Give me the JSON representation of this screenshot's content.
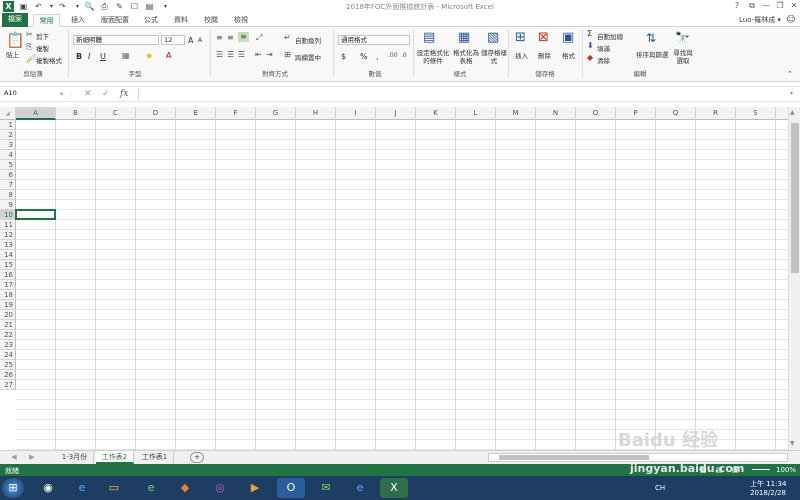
{
  "title_bar": {
    "title": "2018年FOC外面推檢統計表 - Microsoft Excel",
    "qa_icons": [
      "excel-icon",
      "save-icon",
      "undo-icon",
      "redo-icon",
      "print-preview-icon",
      "quick-print-icon",
      "spell-icon",
      "form-icon",
      "more-icon"
    ],
    "window_controls": [
      "?",
      "⧉",
      "—",
      "❐",
      "✕"
    ]
  },
  "tabs": {
    "file": "檔案",
    "items": [
      "常用",
      "插入",
      "版面配置",
      "公式",
      "資料",
      "校閱",
      "檢視"
    ],
    "account": "Luo-羅林成 ▾"
  },
  "ribbon": {
    "clipboard": {
      "paste": "貼上",
      "cut": "剪下",
      "copy": "複製",
      "format_painter": "複製格式",
      "label": "剪貼簿"
    },
    "font": {
      "name": "新細明體",
      "size": "12",
      "label": "字型",
      "grow": "A",
      "shrink": "A",
      "bold": "B",
      "italic": "I",
      "underline": "U",
      "color_a": "A"
    },
    "alignment": {
      "wrap": "自動換列",
      "merge": "跨欄置中",
      "label": "對齊方式"
    },
    "number": {
      "format": "通用格式",
      "currency": "$",
      "percent": "%",
      "comma": ",",
      "label": "數值"
    },
    "styles": {
      "cond": "設定格式化的條件",
      "table": "格式化為表格",
      "cell": "儲存格樣式",
      "label": "樣式"
    },
    "cells": {
      "insert": "插入",
      "delete": "刪除",
      "format": "格式",
      "label": "儲存格"
    },
    "editing": {
      "autosum": "自動加總",
      "fill": "填滿",
      "clear": "清除",
      "sort": "排序與篩選",
      "find": "尋找與選取",
      "label": "編輯"
    }
  },
  "formula_bar": {
    "name_box": "A10",
    "fx": "fx",
    "cancel": "✕",
    "enter": "✓",
    "value": ""
  },
  "columns": [
    "A",
    "B",
    "C",
    "D",
    "E",
    "F",
    "G",
    "H",
    "I",
    "J",
    "K",
    "L",
    "M",
    "N",
    "O",
    "P",
    "Q",
    "R",
    "S"
  ],
  "rows": [
    "1",
    "2",
    "3",
    "4",
    "5",
    "6",
    "7",
    "8",
    "9",
    "10",
    "11",
    "12",
    "13",
    "14",
    "15",
    "16",
    "17",
    "18",
    "19",
    "20",
    "21",
    "22",
    "23",
    "24",
    "25",
    "26",
    "27"
  ],
  "selected_cell": {
    "col": "A",
    "row": "10"
  },
  "sheets": {
    "items": [
      "1-3月份",
      "工作表2",
      "工作表1"
    ],
    "active": "工作表2",
    "add": "+"
  },
  "status": {
    "text": "就緒",
    "zoom": "100%"
  },
  "taskbar": {
    "time": "上午 11:34",
    "date": "2018/2/28",
    "lang": "CH"
  },
  "watermark": {
    "text": "jingyan.baidu.com",
    "logo": "Baidu 经验"
  }
}
